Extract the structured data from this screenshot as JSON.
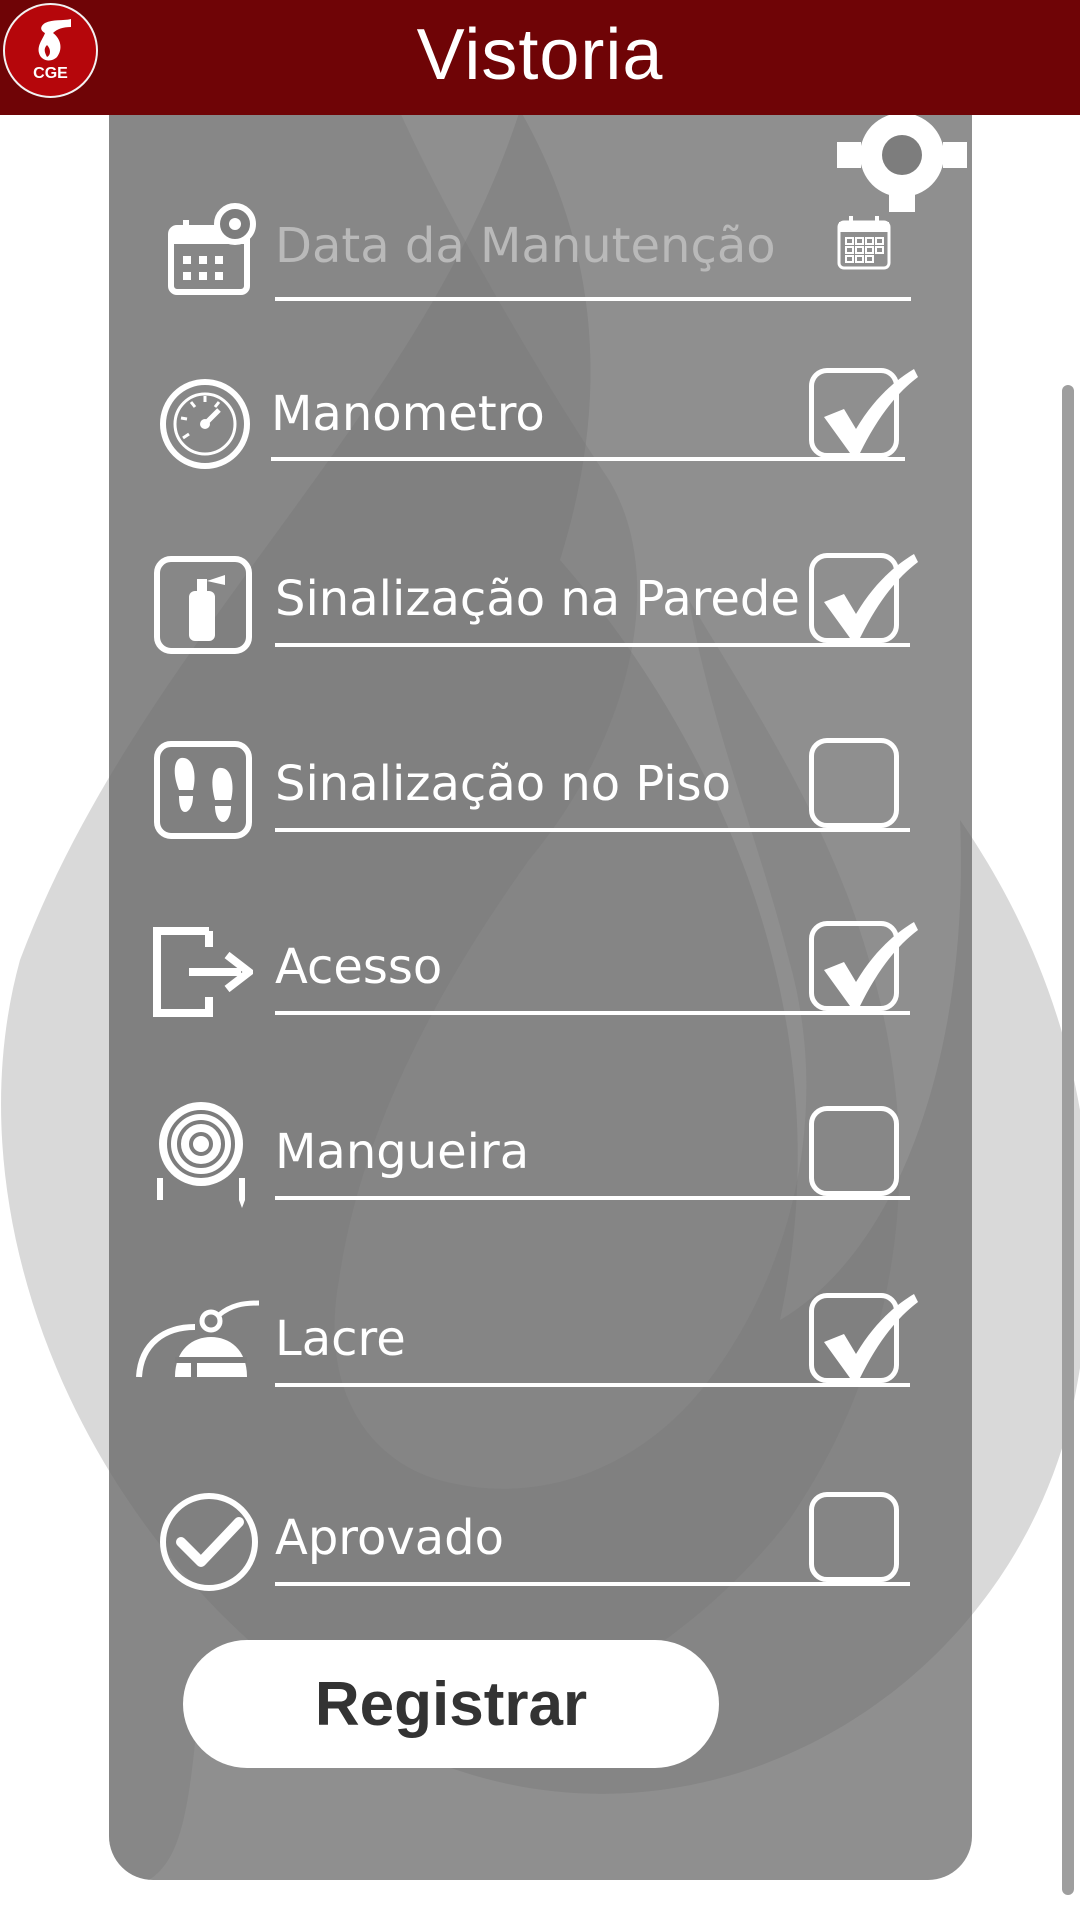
{
  "header": {
    "title": "Vistoria",
    "logo_text": "CGE",
    "background_color": "#6f0406",
    "logo_color": "#b5060b"
  },
  "form": {
    "date_field": {
      "placeholder": "Data da Manutenção",
      "value": "",
      "icon": "calendar-gear-icon",
      "picker_icon": "calendar-icon"
    },
    "items": [
      {
        "label": "Manometro",
        "icon": "pressure-gauge-icon",
        "checked": true
      },
      {
        "label": "Sinalização na Parede",
        "icon": "extinguisher-sign-icon",
        "checked": true
      },
      {
        "label": "Sinalização no Piso",
        "icon": "footprints-sign-icon",
        "checked": false
      },
      {
        "label": "Acesso",
        "icon": "exit-arrow-icon",
        "checked": true
      },
      {
        "label": "Mangueira",
        "icon": "hose-reel-icon",
        "checked": false
      },
      {
        "label": "Lacre",
        "icon": "extinguisher-seal-icon",
        "checked": true
      },
      {
        "label": "Aprovado",
        "icon": "approved-check-icon",
        "checked": false
      }
    ]
  },
  "actions": {
    "register_label": "Registrar"
  }
}
